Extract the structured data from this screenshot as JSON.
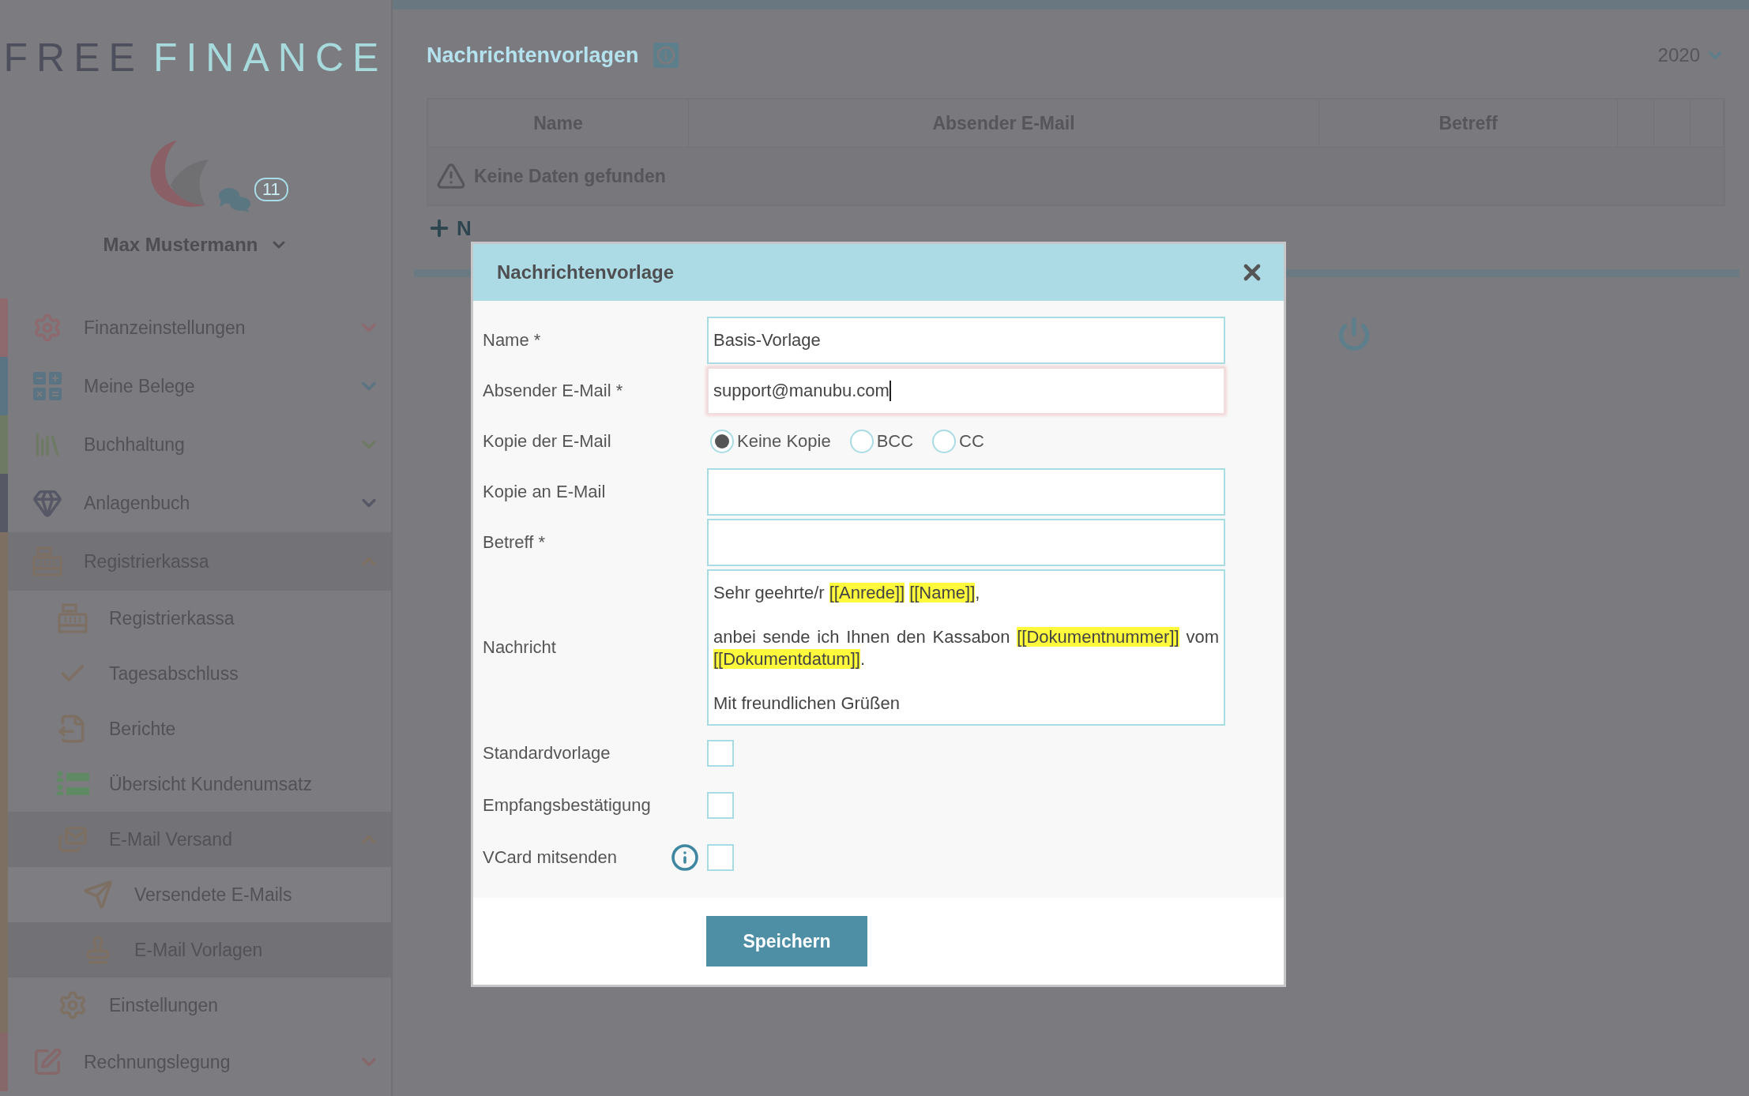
{
  "logo": {
    "first": "FREE",
    "second": "FINANCE"
  },
  "user": {
    "name": "Max Mustermann",
    "message_count": "11"
  },
  "sidebar": {
    "items": [
      {
        "label": "Finanzeinstellungen",
        "color": "#8e6a6f",
        "expanded": false,
        "selected": false
      },
      {
        "label": "Meine Belege",
        "color": "#5b7483",
        "expanded": false,
        "selected": false
      },
      {
        "label": "Buchhaltung",
        "color": "#6f7a64",
        "expanded": false,
        "selected": false
      },
      {
        "label": "Anlagenbuch",
        "color": "#575866",
        "expanded": false,
        "selected": false
      },
      {
        "label": "Registrierkassa",
        "color": "#7d6f62",
        "expanded": true,
        "selected": false,
        "children": [
          {
            "label": "Registrierkassa",
            "selected": false
          },
          {
            "label": "Tagesabschluss",
            "selected": false
          },
          {
            "label": "Berichte",
            "selected": false
          },
          {
            "label": "Übersicht Kundenumsatz",
            "selected": false
          },
          {
            "label": "E-Mail Versand",
            "expanded": true,
            "selected": false,
            "children": [
              {
                "label": "Versendete E-Mails",
                "selected": false
              },
              {
                "label": "E-Mail Vorlagen",
                "selected": true
              }
            ]
          },
          {
            "label": "Einstellungen",
            "selected": false
          }
        ]
      },
      {
        "label": "Rechnungslegung",
        "color": "#86686a",
        "expanded": false,
        "selected": false
      }
    ]
  },
  "page": {
    "title": "Nachrichtenvorlagen",
    "year": "2020",
    "table": {
      "columns": [
        "Name",
        "Absender E-Mail",
        "Betreff"
      ],
      "empty_message": "Keine Daten gefunden"
    },
    "add_button": "N"
  },
  "dialog": {
    "title": "Nachrichtenvorlage",
    "rows": [
      {
        "kind": "text",
        "label": "Name *",
        "value": "Basis-Vorlage",
        "focused": false
      },
      {
        "kind": "text",
        "label": "Absender E-Mail *",
        "value": "support@manubu.com",
        "focused": true
      },
      {
        "kind": "radio",
        "label": "Kopie der E-Mail",
        "options": [
          {
            "label": "Keine Kopie",
            "selected": true
          },
          {
            "label": "BCC",
            "selected": false
          },
          {
            "label": "CC",
            "selected": false
          }
        ]
      },
      {
        "kind": "text",
        "label": "Kopie an E-Mail",
        "focused": false
      },
      {
        "kind": "text",
        "label": "Betreff *",
        "focused": false
      },
      {
        "kind": "textarea",
        "label": "Nachricht",
        "paragraphs": [
          [
            {
              "text": "Sehr geehrte/r ",
              "highlight": false
            },
            {
              "text": "[[Anrede]]",
              "highlight": true
            },
            {
              "text": "[[Name]]",
              "highlight": true
            },
            {
              "text": ",",
              "highlight": false
            }
          ],
          [
            {
              "text": "anbei sende ich Ihnen den Kassabon ",
              "highlight": false
            },
            {
              "text": "[[Dokumentnummer]]",
              "highlight": true
            },
            {
              "text": " vom ",
              "highlight": false
            },
            {
              "text": "[[Dokumentdatum]]",
              "highlight": true
            },
            {
              "text": ".",
              "highlight": false
            }
          ],
          [
            {
              "text": "Mit freundlichen Grüßen",
              "highlight": false
            }
          ]
        ]
      },
      {
        "kind": "checkbox",
        "label": "Standardvorlage",
        "checked": false,
        "info_icon": false
      },
      {
        "kind": "checkbox",
        "label": "Empfangsbestätigung",
        "checked": false,
        "info_icon": false
      },
      {
        "kind": "checkbox",
        "label": "VCard mitsenden",
        "checked": false,
        "info_icon": true
      }
    ],
    "save_button": "Speichern"
  }
}
